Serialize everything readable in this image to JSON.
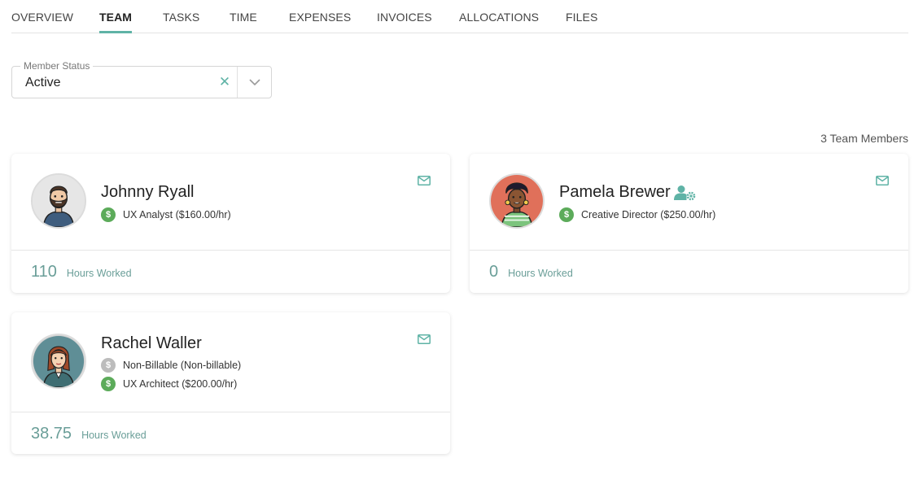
{
  "tabs": [
    {
      "label": "OVERVIEW"
    },
    {
      "label": "TEAM"
    },
    {
      "label": "TASKS"
    },
    {
      "label": "TIME"
    },
    {
      "label": "EXPENSES"
    },
    {
      "label": "INVOICES"
    },
    {
      "label": "ALLOCATIONS"
    },
    {
      "label": "FILES"
    }
  ],
  "active_tab": "TEAM",
  "filter": {
    "label": "Member Status",
    "value": "Active",
    "clear_icon": "close-icon",
    "dropdown_icon": "chevron-down-icon"
  },
  "team": {
    "count_label": "3 Team Members",
    "members": [
      {
        "name": "Johnny Ryall",
        "roles": [
          {
            "label": "UX Analyst ($160.00/hr)",
            "billable": true
          }
        ],
        "hours": "110",
        "hours_label": "Hours Worked"
      },
      {
        "name": "Pamela Brewer",
        "is_admin": true,
        "roles": [
          {
            "label": "Creative Director ($250.00/hr)",
            "billable": true
          }
        ],
        "hours": "0",
        "hours_label": "Hours Worked"
      },
      {
        "name": "Rachel Waller",
        "roles": [
          {
            "label": "Non-Billable (Non-billable)",
            "billable": false
          },
          {
            "label": "UX Architect ($200.00/hr)",
            "billable": true
          }
        ],
        "hours": "38.75",
        "hours_label": "Hours Worked"
      }
    ],
    "role_icon_symbol": "$",
    "mail_icon": "mail-icon"
  },
  "colors": {
    "accent": "#5fb3a6",
    "billable": "#5cab5a",
    "non_billable": "#bcbcbc",
    "hours_text": "#6a9e98"
  }
}
